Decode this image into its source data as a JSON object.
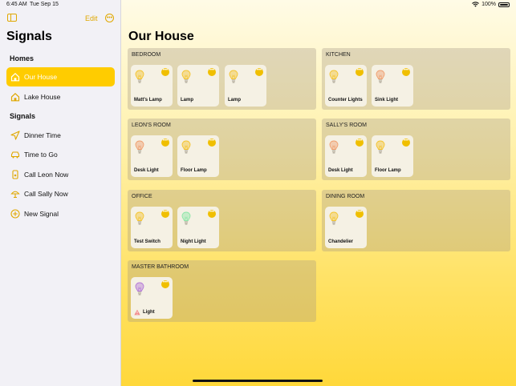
{
  "status_bar": {
    "time": "6:45 AM",
    "date": "Tue Sep 15",
    "battery": "100%"
  },
  "sidebar": {
    "edit_label": "Edit",
    "title": "Signals",
    "homes_header": "Homes",
    "homes": [
      {
        "label": "Our House",
        "icon": "house-icon",
        "selected": true
      },
      {
        "label": "Lake House",
        "icon": "house-icon"
      }
    ],
    "signals_header": "Signals",
    "signals": [
      {
        "label": "Dinner Time",
        "icon": "paper-plane-icon"
      },
      {
        "label": "Time to Go",
        "icon": "car-icon"
      },
      {
        "label": "Call Leon Now",
        "icon": "phone-icon"
      },
      {
        "label": "Call Sally Now",
        "icon": "lamp-icon"
      },
      {
        "label": "New Signal",
        "icon": "plus-circle-icon"
      }
    ]
  },
  "main": {
    "title": "Our House",
    "rooms": [
      {
        "name": "BEDROOM",
        "devices": [
          {
            "name": "Matt's Lamp",
            "color": "#f4c430"
          },
          {
            "name": "Lamp",
            "color": "#f4c430"
          },
          {
            "name": "Lamp",
            "color": "#f4c430"
          }
        ]
      },
      {
        "name": "KITCHEN",
        "devices": [
          {
            "name": "Counter Lights",
            "color": "#f4c430"
          },
          {
            "name": "Sink Light",
            "color": "#f0a070"
          }
        ]
      },
      {
        "name": "LEON'S ROOM",
        "devices": [
          {
            "name": "Desk Light",
            "color": "#f0a070"
          },
          {
            "name": "Floor Lamp",
            "color": "#f4c430"
          }
        ]
      },
      {
        "name": "SALLY'S ROOM",
        "devices": [
          {
            "name": "Desk Light",
            "color": "#f0a070"
          },
          {
            "name": "Floor Lamp",
            "color": "#f4c430"
          }
        ]
      },
      {
        "name": "OFFICE",
        "devices": [
          {
            "name": "Test Switch",
            "color": "#f4c430"
          },
          {
            "name": "Night Light",
            "color": "#8ee6a8"
          }
        ]
      },
      {
        "name": "DINING ROOM",
        "devices": [
          {
            "name": "Chandelier",
            "color": "#f4c430"
          }
        ]
      },
      {
        "name": "MASTER BATHROOM",
        "devices": [
          {
            "name": "Light",
            "color": "#b57ad8",
            "warning": true
          }
        ]
      }
    ]
  }
}
